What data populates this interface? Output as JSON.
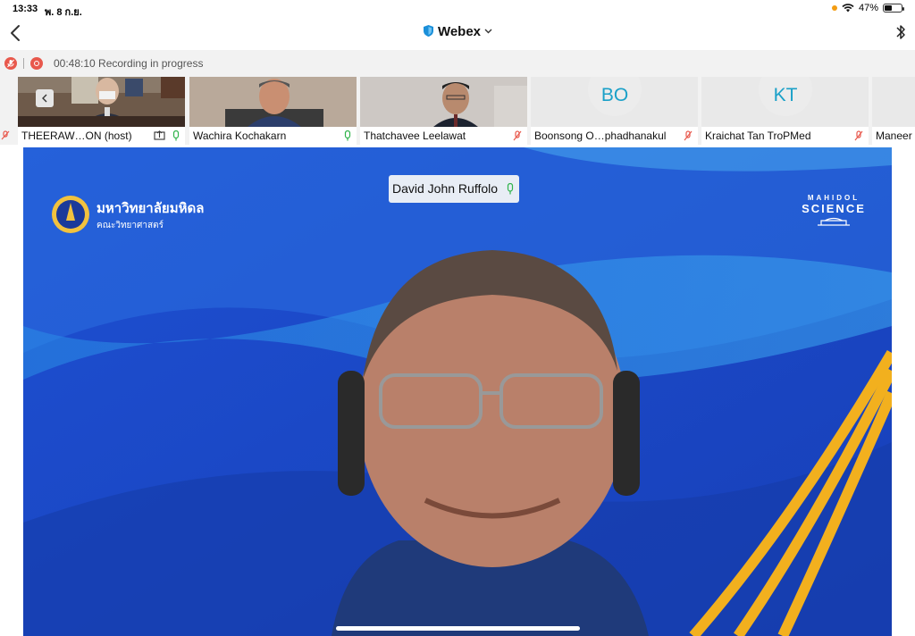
{
  "status": {
    "time": "13:33",
    "date": "พ. 8 ก.ย.",
    "battery_text": "47%",
    "battery_level": 0.47
  },
  "nav": {
    "title": "Webex"
  },
  "recording": {
    "text": "00:48:10 Recording in progress"
  },
  "participants": [
    {
      "name": "THEERAW…ON (host)",
      "muted": false,
      "sharing": true
    },
    {
      "name": "Wachira Kochakarn",
      "muted": false
    },
    {
      "name": "Thatchavee Leelawat",
      "muted": true
    },
    {
      "name": "Boonsong O…phadhanakul",
      "initials": "BO",
      "muted": true
    },
    {
      "name": "Kraichat Tan TroPMed",
      "initials": "KT",
      "muted": true
    },
    {
      "name": "Maneer"
    }
  ],
  "stage": {
    "speaker_name": "David John Ruffolo",
    "logo_left_line1": "มหาวิทยาลัยมหิดล",
    "logo_left_line2": "คณะวิทยาศาสตร์",
    "logo_right_arc": "MAHIDOL",
    "logo_right_word": "SCIENCE"
  },
  "colors": {
    "accent_mic_on": "#2fb34a",
    "accent_mic_off": "#e8584c",
    "stage_blue": "#1b49c9",
    "gold": "#f2b01e",
    "initials": "#1aa0c8"
  }
}
